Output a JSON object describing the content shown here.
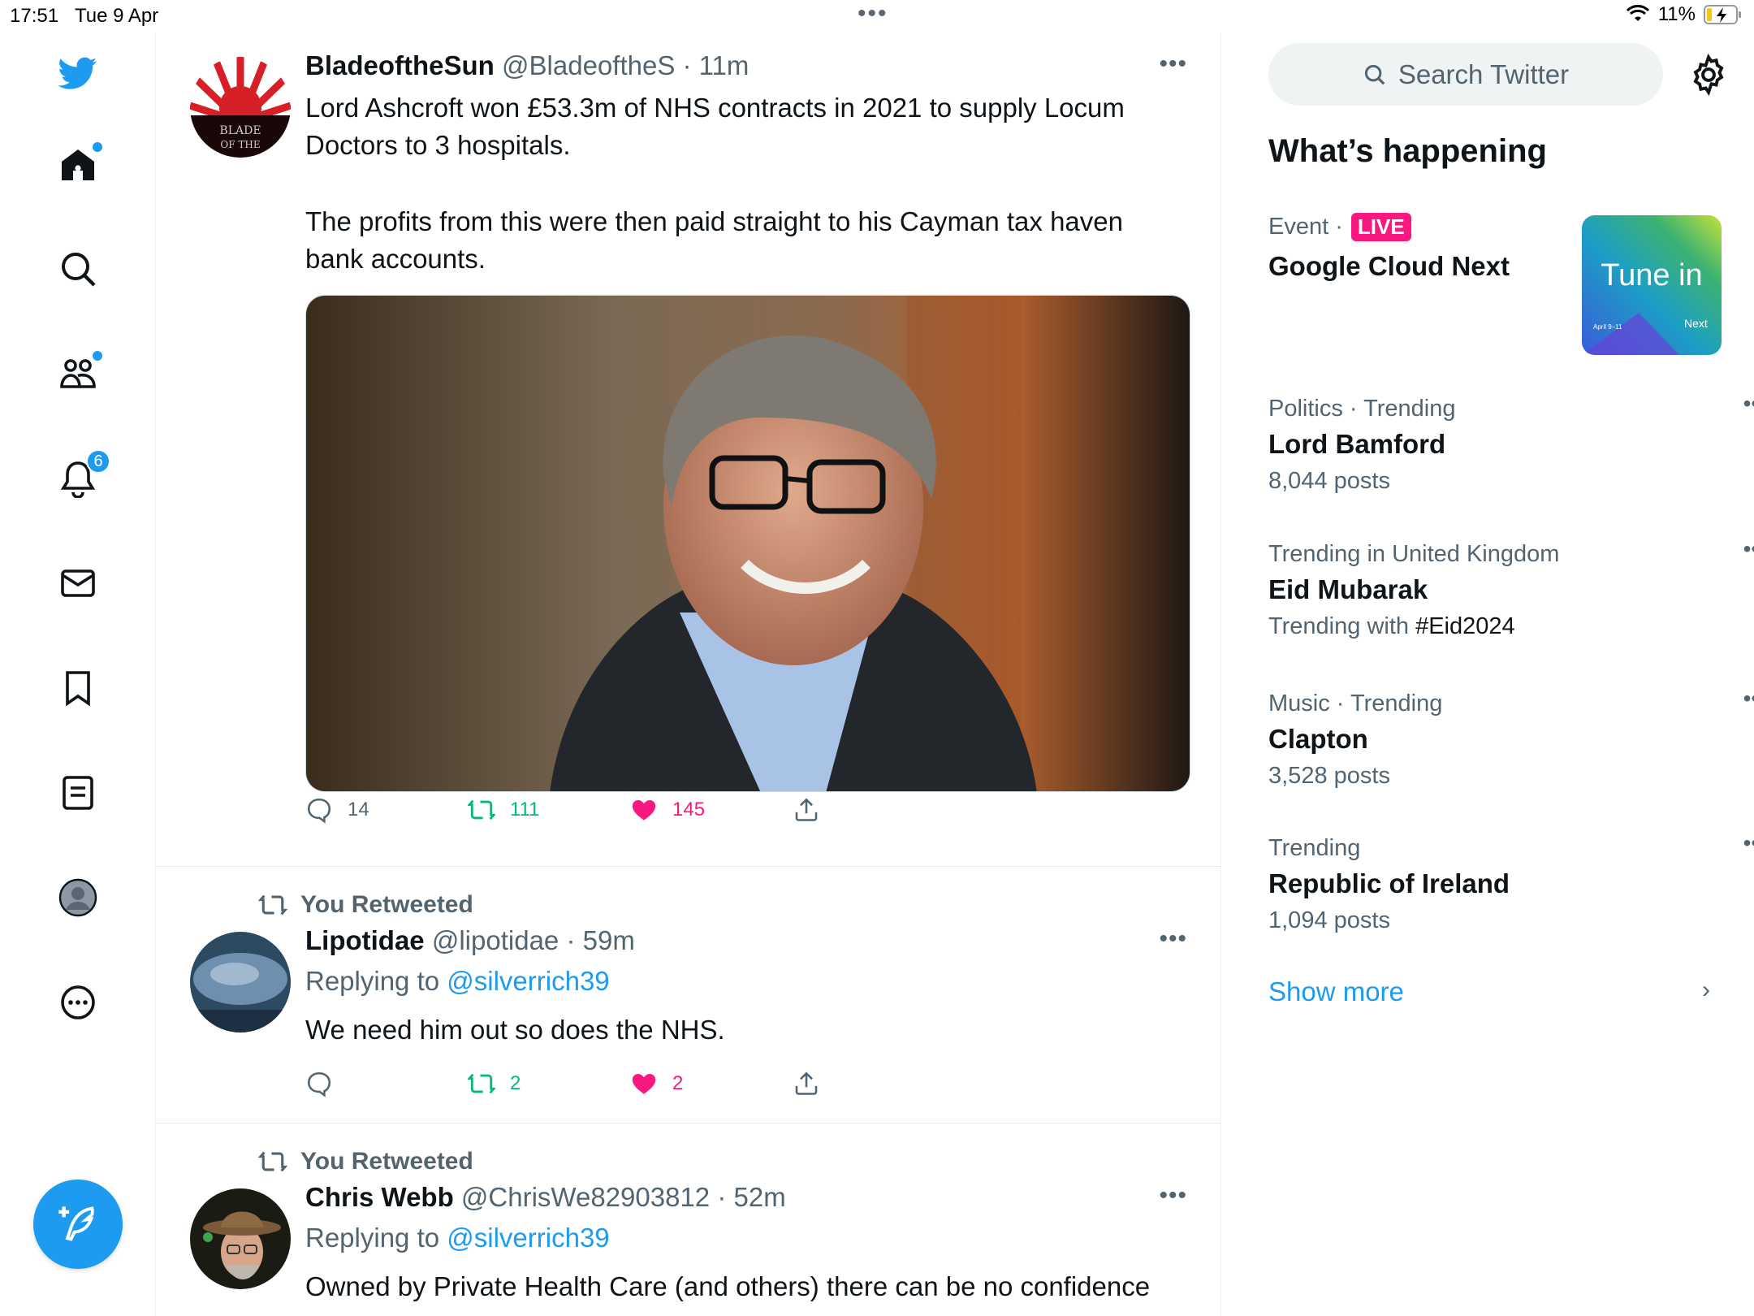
{
  "status": {
    "time": "17:51",
    "date": "Tue 9 Apr",
    "battery": "11%",
    "dots": "•••"
  },
  "nav": {
    "notifications_badge": "6"
  },
  "tweets": [
    {
      "name": "BladeoftheSun",
      "handle": "@BladeoftheS",
      "time": "· 11m",
      "text1": "Lord Ashcroft won £53.3m of NHS contracts in 2021 to supply Locum Doctors to 3 hospitals.",
      "text2": "The profits from this were then paid straight to his Cayman tax haven bank accounts.",
      "avatar_text": "BLADE OF THE",
      "replies": "14",
      "retweets": "111",
      "likes": "145",
      "more": "•••"
    },
    {
      "retweet_label": "You Retweeted",
      "name": "Lipotidae",
      "handle": "@lipotidae",
      "time": "· 59m",
      "replying_prefix": "Replying to ",
      "replying_to": "@silverrich39",
      "text": "We need him out so does the NHS.",
      "replies": "",
      "retweets": "2",
      "likes": "2",
      "more": "•••"
    },
    {
      "retweet_label": "You Retweeted",
      "name": "Chris Webb",
      "handle": "@ChrisWe82903812",
      "time": "· 52m",
      "replying_prefix": "Replying to ",
      "replying_to": "@silverrich39",
      "text": "Owned by Private Health Care (and others) there can be no confidence",
      "more": "•••"
    }
  ],
  "right": {
    "search_placeholder": "Search Twitter",
    "whats_happening": "What’s happening",
    "event": {
      "category": "Event ·",
      "live": "LIVE",
      "title": "Google Cloud Next",
      "image_text": "Tune in",
      "image_small1": "April 9–11",
      "image_small2": "Next"
    },
    "trends": [
      {
        "category": "Politics · Trending",
        "name": "Lord Bamford",
        "count": "8,044 posts"
      },
      {
        "category": "Trending in United Kingdom",
        "name": "Eid Mubarak",
        "count_prefix": "Trending with ",
        "count_tag": "#Eid2024"
      },
      {
        "category": "Music · Trending",
        "name": "Clapton",
        "count": "3,528 posts"
      },
      {
        "category": "Trending",
        "name": "Republic of Ireland",
        "count": "1,094 posts"
      }
    ],
    "trend_more": "•••",
    "show_more": "Show more",
    "show_more_chevron": "›"
  },
  "colors": {
    "accent": "#1d9bf0",
    "retweet": "#00ba7c",
    "like": "#f91880",
    "muted": "#536471"
  }
}
